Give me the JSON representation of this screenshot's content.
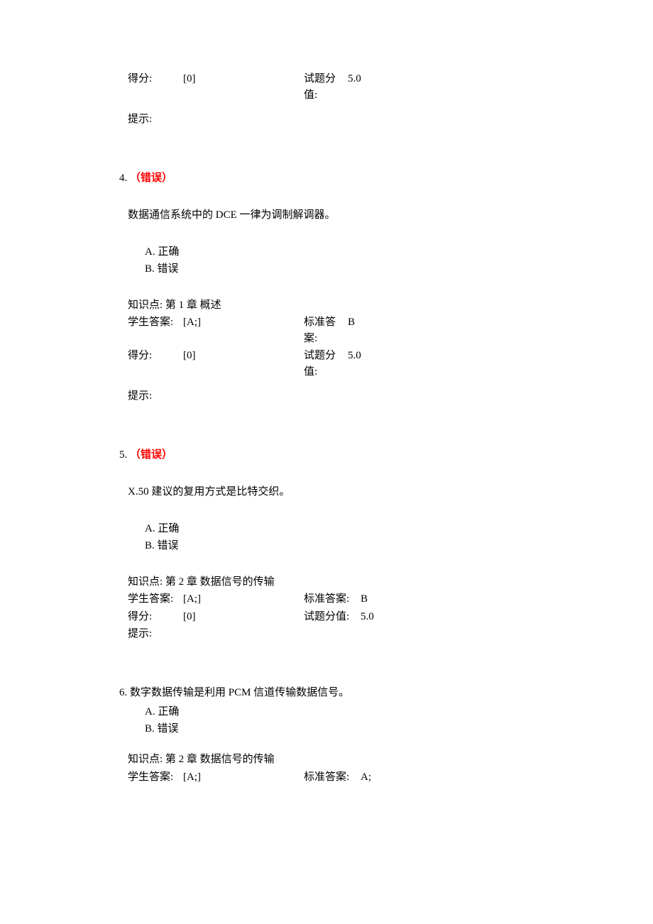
{
  "top": {
    "score_label": "得分:",
    "score_value": "[0]",
    "maxscore_label": "试题分值:",
    "maxscore_value": "5.0",
    "tip_label": "提示:"
  },
  "q4": {
    "num": "4.",
    "status": "（错误）",
    "text": "数据通信系统中的 DCE 一律为调制解调器。",
    "optA": "A.  正确",
    "optB": "B.  错误",
    "kp_label": "知识点:",
    "kp_value": "第 1 章  概述",
    "sa_label": "学生答案:",
    "sa_value": "[A;]",
    "std_label": "标准答案:",
    "std_value": "B",
    "score_label": "得分:",
    "score_value": "[0]",
    "max_label": "试题分值:",
    "max_value": "5.0",
    "tip_label": "提示:"
  },
  "q5": {
    "num": "5.",
    "status": "（错误）",
    "text": "X.50 建议的复用方式是比特交织。",
    "optA": "A.  正确",
    "optB": "B.  错误",
    "kp_label": "知识点:",
    "kp_value": "第 2 章  数据信号的传输",
    "sa_label": "学生答案:",
    "sa_value": "[A;]",
    "std_label": "标准答案:",
    "std_value": "B",
    "score_label": "得分:",
    "score_value": "[0]",
    "max_label": "试题分值:",
    "max_value": "5.0",
    "tip_label": "提示:"
  },
  "q6": {
    "num": "6.",
    "text": "数字数据传输是利用 PCM 信道传输数据信号。",
    "optA": "A.  正确",
    "optB": "B.  错误",
    "kp_label": "知识点:",
    "kp_value": "第 2 章  数据信号的传输",
    "sa_label": "学生答案:",
    "sa_value": "[A;]",
    "std_label": "标准答案:",
    "std_value": "A;"
  }
}
